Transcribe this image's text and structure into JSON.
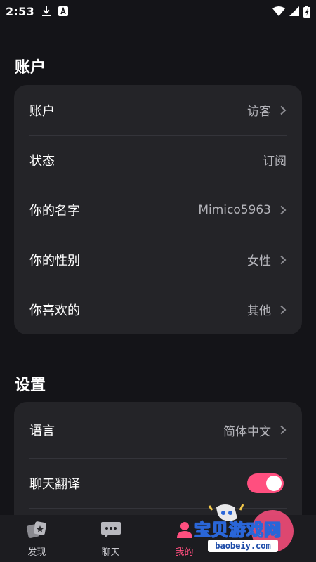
{
  "status_bar": {
    "time": "2:53"
  },
  "sections": {
    "account": {
      "title": "账户",
      "rows": [
        {
          "label": "账户",
          "value": "访客"
        },
        {
          "label": "状态",
          "value": "订阅"
        },
        {
          "label": "你的名字",
          "value": "Mimico5963"
        },
        {
          "label": "你的性别",
          "value": "女性"
        },
        {
          "label": "你喜欢的",
          "value": "其他"
        }
      ]
    },
    "settings": {
      "title": "设置",
      "rows": [
        {
          "label": "语言",
          "value": "简体中文"
        },
        {
          "label": "聊天翻译",
          "toggle_on": true
        }
      ]
    }
  },
  "bottom_nav": {
    "items": [
      {
        "label": "发现",
        "icon": "discover-icon"
      },
      {
        "label": "聊天",
        "icon": "chat-icon"
      },
      {
        "label": "我的",
        "icon": "profile-icon",
        "active": true
      }
    ]
  },
  "watermark": {
    "title": "宝贝游戏网",
    "url": "baobeiy.com"
  },
  "colors": {
    "accent": "#ff4f7f",
    "background": "#141418",
    "card": "#242428"
  }
}
